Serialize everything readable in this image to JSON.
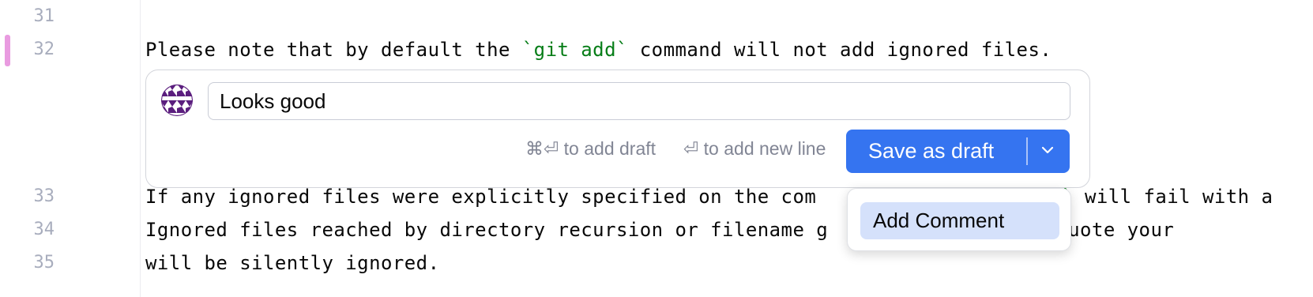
{
  "editor": {
    "gutter": {
      "line_numbers": [
        "31",
        "32",
        "33",
        "34",
        "35"
      ]
    },
    "lines": {
      "l32": {
        "before": "Please note that by default the ",
        "code": "`git add`",
        "after": " command will not add ignored files."
      },
      "l33": {
        "before": "If any ignored files were explicitly specified on the com",
        "code": "d`",
        "after": " will fail with a"
      },
      "l34": {
        "text": "Ignored files reached by directory recursion or filename g"
      },
      "l34_tail": {
        "text": " by Git (quote your"
      },
      "l35": {
        "text": "will be silently ignored."
      }
    }
  },
  "comment_editor": {
    "avatar_icon": "user-avatar-icon",
    "input_value": "Looks good",
    "hint_add_draft": "⌘⏎ to add draft",
    "hint_new_line": "⏎ to add new line",
    "save_button_label": "Save as draft",
    "dropdown_icon": "chevron-down-icon",
    "colors": {
      "primary": "#3574f0",
      "menu_highlight": "#d5e1fb",
      "change_marker": "#e99be0",
      "code_green": "#067d17"
    }
  },
  "dropdown_menu": {
    "items": [
      "Add Comment"
    ]
  }
}
